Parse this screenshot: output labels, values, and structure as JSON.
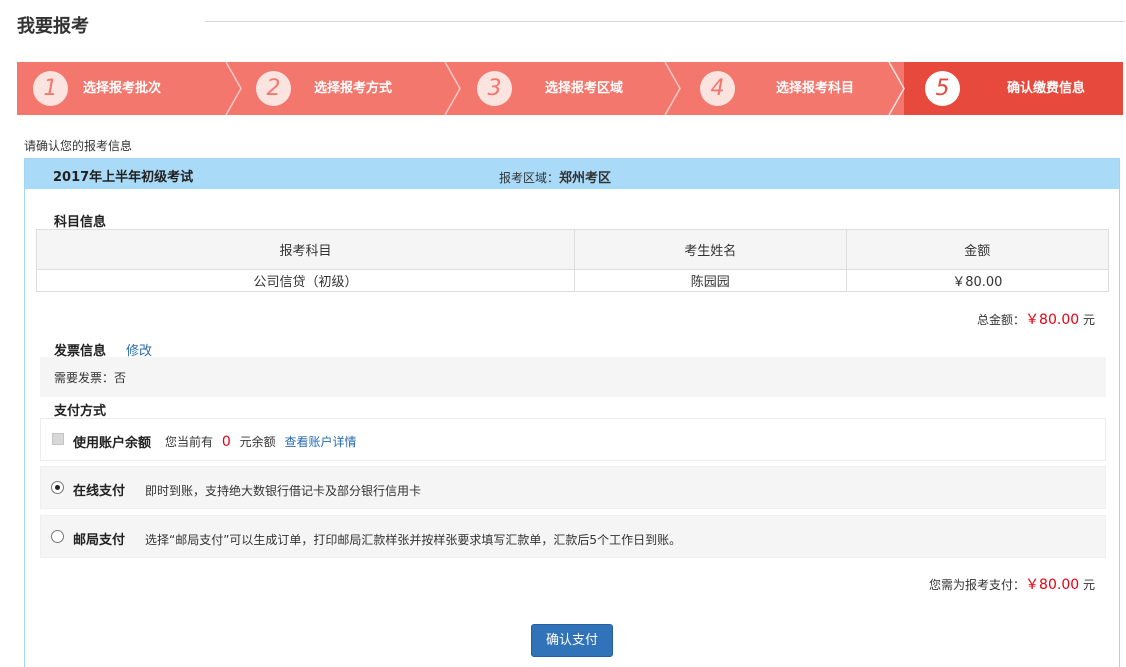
{
  "page": {
    "title": "我要报考"
  },
  "steps": [
    {
      "num": "1",
      "label": "选择报考批次"
    },
    {
      "num": "2",
      "label": "选择报考方式"
    },
    {
      "num": "3",
      "label": "选择报考区域"
    },
    {
      "num": "4",
      "label": "选择报考科目"
    },
    {
      "num": "5",
      "label": "确认缴费信息"
    }
  ],
  "colors": {
    "step_bg": "#f4776d",
    "step_active": "#e7493c",
    "header_blue": "#a9dbf9",
    "price_red": "#e60012",
    "link_blue": "#2a6bb0",
    "button_blue": "#3173b8"
  },
  "confirm_hint": "请确认您的报考信息",
  "exam": {
    "name": "2017年上半年初级考试",
    "region_label": "报考区域：",
    "region_value": "郑州考区"
  },
  "subjects": {
    "title": "科目信息",
    "columns": [
      "报考科目",
      "考生姓名",
      "金额"
    ],
    "rows": [
      [
        "公司信贷（初级）",
        "陈园园",
        "￥80.00"
      ]
    ]
  },
  "total": {
    "label": "总金额：",
    "amount": "￥80.00",
    "unit": "元"
  },
  "invoice": {
    "title": "发票信息",
    "edit": "修改",
    "need_invoice": "需要发票：否"
  },
  "payment": {
    "title": "支付方式",
    "balance": {
      "name": "使用账户余额",
      "prefix": "您当前有",
      "amount": "0",
      "suffix": "元余额",
      "link": "查看账户详情",
      "checked": false
    },
    "online": {
      "name": "在线支付",
      "desc": "即时到账，支持绝大数银行借记卡及部分银行信用卡",
      "selected": true
    },
    "post": {
      "name": "邮局支付",
      "desc": "选择“邮局支付”可以生成订单，打印邮局汇款样张并按样张要求填写汇款单，汇款后5个工作日到账。",
      "selected": false
    }
  },
  "pay_total": {
    "label": "您需为报考支付：",
    "amount": "￥80.00",
    "unit": "元"
  },
  "submit": {
    "label": "确认支付"
  }
}
